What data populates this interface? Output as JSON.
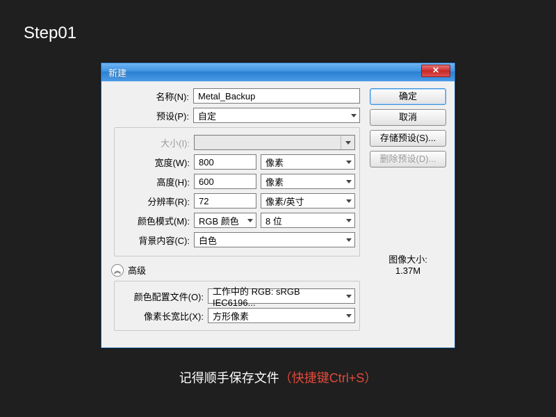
{
  "step_title": "Step01",
  "dialog": {
    "title": "新建",
    "close_glyph": "✕",
    "fields": {
      "name_label": "名称(N):",
      "name_value": "Metal_Backup",
      "preset_label": "预设(P):",
      "preset_value": "自定",
      "size_label": "大小(I):",
      "size_value": "",
      "width_label": "宽度(W):",
      "width_value": "800",
      "width_unit": "像素",
      "height_label": "高度(H):",
      "height_value": "600",
      "height_unit": "像素",
      "resolution_label": "分辨率(R):",
      "resolution_value": "72",
      "resolution_unit": "像素/英寸",
      "color_mode_label": "颜色模式(M):",
      "color_mode_value": "RGB 颜色",
      "color_depth_value": "8 位",
      "bg_label": "背景内容(C):",
      "bg_value": "白色",
      "advanced_label": "高级",
      "profile_label": "颜色配置文件(O):",
      "profile_value": "工作中的 RGB: sRGB IEC6196...",
      "aspect_label": "像素长宽比(X):",
      "aspect_value": "方形像素"
    },
    "buttons": {
      "ok": "确定",
      "cancel": "取消",
      "save_preset": "存储预设(S)...",
      "delete_preset": "删除预设(D)..."
    },
    "image_size_label": "图像大小:",
    "image_size_value": "1.37M"
  },
  "footer": {
    "text": "记得顺手保存文件",
    "hotkey": "（快捷键Ctrl+S）"
  }
}
